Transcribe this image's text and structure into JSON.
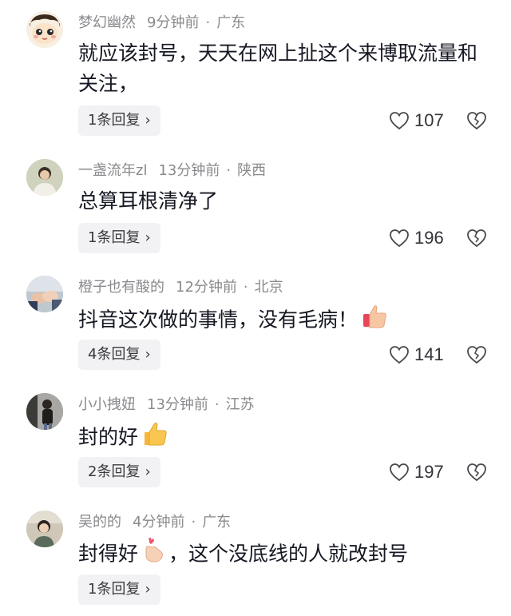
{
  "comments": [
    {
      "username": "梦幻幽然",
      "time": "9分钟前",
      "location": "广东",
      "text": "就应该封号，天天在网上扯这个来博取流量和关注，",
      "replies": "1条回复",
      "likes": "107",
      "avatar": "cartoon-face"
    },
    {
      "username": "一盏流年zl",
      "time": "13分钟前",
      "location": "陕西",
      "text": "总算耳根清净了",
      "replies": "1条回复",
      "likes": "196",
      "avatar": "person-photo"
    },
    {
      "username": "橙子也有酸的",
      "time": "12分钟前",
      "location": "北京",
      "text": "抖音这次做的事情，没有毛病！",
      "replies": "4条回复",
      "likes": "141",
      "emoji": "thumbs-up",
      "avatar": "hands-photo"
    },
    {
      "username": "小小拽妞",
      "time": "13分钟前",
      "location": "江苏",
      "text": "封的好",
      "replies": "2条回复",
      "likes": "197",
      "emoji": "thumbs-up",
      "avatar": "person-photo"
    },
    {
      "username": "吴的的",
      "time": "4分钟前",
      "location": "广东",
      "text_before": "封得好",
      "text_after": "，这个没底线的人就改封号",
      "replies": "1条回复",
      "emoji": "finger-heart",
      "avatar": "person-photo"
    }
  ],
  "colors": {
    "meta": "#8a8a8e",
    "text": "#161823",
    "reply_bg": "#f2f2f4"
  }
}
